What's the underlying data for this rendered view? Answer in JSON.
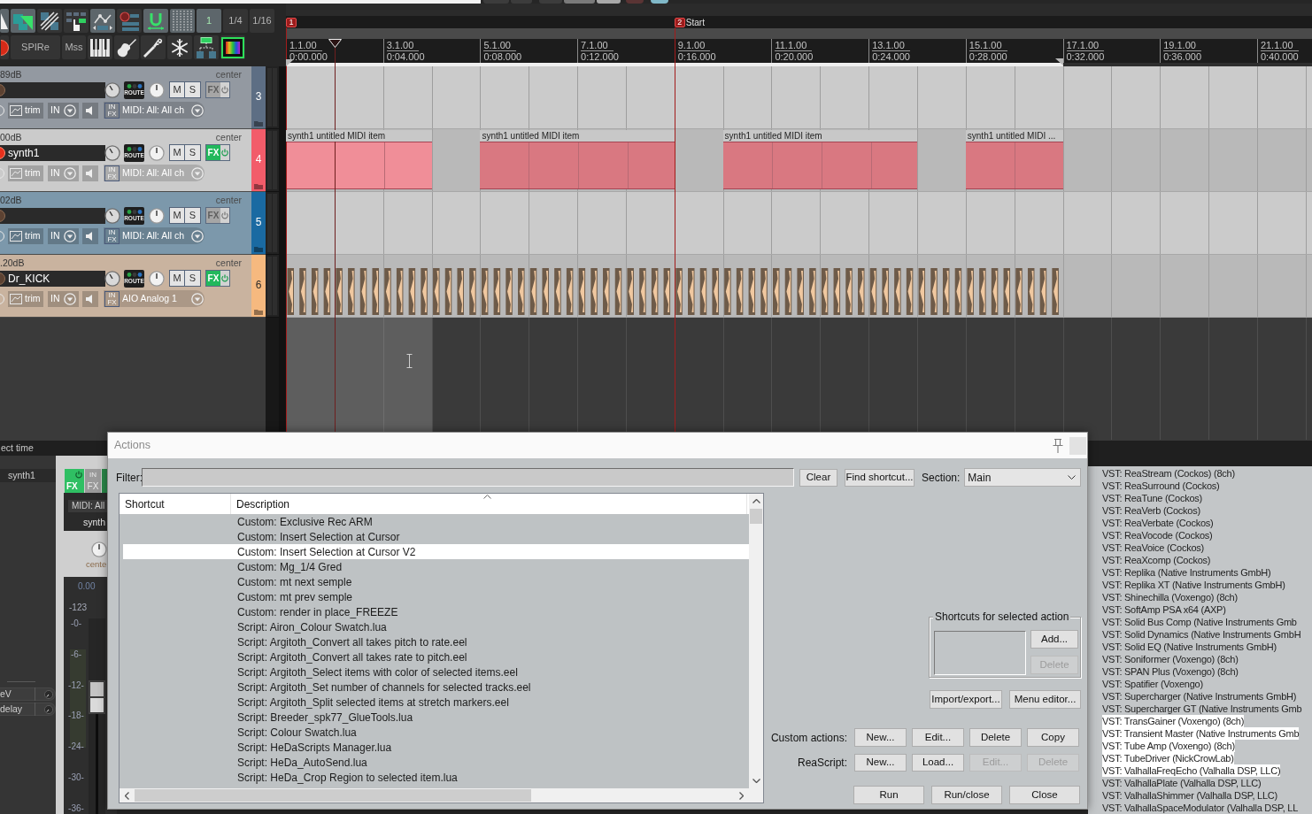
{
  "toolbar": {
    "rows": [
      [
        {
          "kind": "icon",
          "on": true
        },
        {
          "kind": "icon",
          "on": true
        },
        {
          "kind": "icon",
          "on": false
        },
        {
          "kind": "icon",
          "on": false
        },
        {
          "kind": "icon",
          "on": true
        },
        {
          "kind": "icon",
          "on": false
        },
        {
          "kind": "icon",
          "on": true
        },
        {
          "kind": "icon",
          "on": true
        },
        {
          "kind": "text",
          "label": "1",
          "on": true
        },
        {
          "kind": "text",
          "label": "1/4",
          "on": false
        },
        {
          "kind": "text",
          "label": "1/16",
          "on": false
        }
      ],
      [
        {
          "kind": "icon",
          "on": false
        },
        {
          "kind": "text",
          "label": "SPIRe",
          "on": false
        },
        {
          "kind": "text",
          "label": "Mss",
          "on": false
        },
        {
          "kind": "icon",
          "on": false
        },
        {
          "kind": "icon",
          "on": false
        },
        {
          "kind": "icon",
          "on": false
        },
        {
          "kind": "icon",
          "on": false
        },
        {
          "kind": "icon",
          "on": false
        },
        {
          "kind": "icon",
          "on": false
        }
      ]
    ]
  },
  "tracks": [
    {
      "number": "3",
      "volume": "89dB",
      "pan": "center",
      "armed": false,
      "fx_on": false,
      "selected": false,
      "color": "#5d6e84",
      "route_label": "ROUTE",
      "mute_label": "M",
      "solo_label": "S",
      "fx_label": "FX",
      "trim_label": "trim",
      "in_label": "IN",
      "input_fx": [
        "IN",
        "FX"
      ],
      "input": "MIDI: All: All ch",
      "kind": "empty"
    },
    {
      "number": "4",
      "volume": "00dB",
      "pan": "center",
      "name": "synth1",
      "armed": true,
      "fx_on": true,
      "selected": true,
      "color": "#f25c6a",
      "route_label": "ROUTE",
      "mute_label": "M",
      "solo_label": "S",
      "fx_label": "FX",
      "trim_label": "trim",
      "in_label": "IN",
      "input_fx": [
        "IN",
        "FX"
      ],
      "input": "MIDI: All: All ch",
      "kind": "midi",
      "items": [
        {
          "label": "synth1 untitled MIDI item",
          "selected": true
        },
        {
          "label": "synth1 untitled MIDI item",
          "selected": false
        },
        {
          "label": "synth1 untitled MIDI item",
          "selected": false
        },
        {
          "label": "synth1 untitled MIDI ...",
          "selected": false
        }
      ]
    },
    {
      "number": "5",
      "volume": "02dB",
      "pan": "center",
      "armed": false,
      "fx_on": false,
      "selected": false,
      "color": "#1a6aa2",
      "route_label": "ROUTE",
      "mute_label": "M",
      "solo_label": "S",
      "fx_label": "FX",
      "trim_label": "trim",
      "in_label": "IN",
      "input_fx": [
        "IN",
        "FX"
      ],
      "input": "MIDI: All: All ch",
      "kind": "empty"
    },
    {
      "number": "6",
      "volume": ".20dB",
      "pan": "center",
      "name": "Dr_KICK",
      "armed": false,
      "fx_on": true,
      "selected": false,
      "color": "#f6b97f",
      "route_label": "ROUTE",
      "mute_label": "M",
      "solo_label": "S",
      "fx_label": "FX",
      "trim_label": "trim",
      "in_label": "IN",
      "input_fx": [
        "IN",
        "FX"
      ],
      "input": "AIO Analog 1",
      "kind": "audio"
    }
  ],
  "markers": [
    {
      "number": "1"
    },
    {
      "number": "2",
      "name": "Start"
    }
  ],
  "ruler": [
    {
      "bar": "1.1.00",
      "time": "0:00.000"
    },
    {
      "bar": "3.1.00",
      "time": "0:04.000"
    },
    {
      "bar": "5.1.00",
      "time": "0:08.000"
    },
    {
      "bar": "7.1.00",
      "time": "0:12.000"
    },
    {
      "bar": "9.1.00",
      "time": "0:16.000"
    },
    {
      "bar": "11.1.00",
      "time": "0:20.000"
    },
    {
      "bar": "13.1.00",
      "time": "0:24.000"
    },
    {
      "bar": "15.1.00",
      "time": "0:28.000"
    },
    {
      "bar": "17.1.00",
      "time": "0:32.000"
    },
    {
      "bar": "19.1.00",
      "time": "0:36.000"
    },
    {
      "bar": "21.1.00",
      "time": "0:40.000"
    }
  ],
  "status_strip": {
    "text": "ect time"
  },
  "fx_chain_panel": {
    "title": "synth1",
    "params": [
      "eV",
      "delay"
    ]
  },
  "mixer_strip": {
    "fx": {
      "label": "FX",
      "on": true
    },
    "input_fx": {
      "top": "IN",
      "label": "FX"
    },
    "input": "MIDI: All",
    "name": "synth",
    "pan": "cente",
    "volume": "0.00",
    "peak": "-123",
    "scale": [
      "-0-",
      "-6-",
      "-12-",
      "-18-",
      "-24-",
      "-30-",
      "-36-"
    ],
    "fader": {
      "level": 0.6
    }
  },
  "actions_dialog": {
    "title": "Actions",
    "filter_label": "Filter:",
    "clear_button": "Clear",
    "find_button": "Find shortcut...",
    "section_label": "Section:",
    "section_value": "Main",
    "columns": [
      "Shortcut",
      "Description"
    ],
    "rows": [
      {
        "description": "Custom: Exclusive Rec ARM",
        "selected": false
      },
      {
        "description": "Custom: Insert Selection at Cursor",
        "selected": false
      },
      {
        "description": "Custom: Insert Selection at Cursor V2",
        "selected": true
      },
      {
        "description": "Custom: Mg_1/4 Gred",
        "selected": false
      },
      {
        "description": "Custom: mt next semple",
        "selected": false
      },
      {
        "description": "Custom: mt prev semple",
        "selected": false
      },
      {
        "description": "Custom: render in place_FREEZE",
        "selected": false
      },
      {
        "description": "Script: Airon_Colour Swatch.lua",
        "selected": false
      },
      {
        "description": "Script: Argitoth_Convert all takes pitch to rate.eel",
        "selected": false
      },
      {
        "description": "Script: Argitoth_Convert all takes rate to pitch.eel",
        "selected": false
      },
      {
        "description": "Script: Argitoth_Select items with color of selected items.eel",
        "selected": false
      },
      {
        "description": "Script: Argitoth_Set number of channels for selected tracks.eel",
        "selected": false
      },
      {
        "description": "Script: Argitoth_Split selected items at stretch markers.eel",
        "selected": false
      },
      {
        "description": "Script: Breeder_spk77_GlueTools.lua",
        "selected": false
      },
      {
        "description": "Script: Colour Swatch.lua",
        "selected": false
      },
      {
        "description": "Script: HeDaScripts Manager.lua",
        "selected": false
      },
      {
        "description": "Script: HeDa_AutoSend.lua",
        "selected": false
      },
      {
        "description": "Script: HeDa_Crop Region to selected item.lua",
        "selected": false
      }
    ],
    "shortcuts_group": {
      "title": "Shortcuts for selected action",
      "buttons": [
        {
          "label": "Add...",
          "disabled": false
        },
        {
          "label": "Delete",
          "disabled": true
        }
      ]
    },
    "tool_buttons": [
      "Import/export...",
      "Menu editor..."
    ],
    "custom_actions": {
      "label": "Custom actions:",
      "buttons": [
        {
          "label": "New...",
          "disabled": false
        },
        {
          "label": "Edit...",
          "disabled": false
        },
        {
          "label": "Delete",
          "disabled": false
        },
        {
          "label": "Copy",
          "disabled": false
        }
      ]
    },
    "reascript": {
      "label": "ReaScript:",
      "buttons": [
        {
          "label": "New...",
          "disabled": false
        },
        {
          "label": "Load...",
          "disabled": false
        },
        {
          "label": "Edit...",
          "disabled": true
        },
        {
          "label": "Delete",
          "disabled": true
        }
      ]
    },
    "run_buttons": [
      "Run",
      "Run/close",
      "Close"
    ]
  },
  "fx_browser": {
    "items": [
      {
        "label": "VST: ReaStream (Cockos) (8ch)",
        "selected": false
      },
      {
        "label": "VST: ReaSurround (Cockos)",
        "selected": false
      },
      {
        "label": "VST: ReaTune (Cockos)",
        "selected": false
      },
      {
        "label": "VST: ReaVerb (Cockos)",
        "selected": false
      },
      {
        "label": "VST: ReaVerbate (Cockos)",
        "selected": false
      },
      {
        "label": "VST: ReaVocode (Cockos)",
        "selected": false
      },
      {
        "label": "VST: ReaVoice (Cockos)",
        "selected": false
      },
      {
        "label": "VST: ReaXcomp (Cockos)",
        "selected": false
      },
      {
        "label": "VST: Replika (Native Instruments GmbH)",
        "selected": false
      },
      {
        "label": "VST: Replika XT (Native Instruments GmbH)",
        "selected": false
      },
      {
        "label": "VST: Shinechilla (Voxengo) (8ch)",
        "selected": false
      },
      {
        "label": "VST: SoftAmp PSA x64 (AXP)",
        "selected": false
      },
      {
        "label": "VST: Solid Bus Comp (Native Instruments Gmb",
        "selected": false
      },
      {
        "label": "VST: Solid Dynamics (Native Instruments GmbH",
        "selected": false
      },
      {
        "label": "VST: Solid EQ (Native Instruments GmbH)",
        "selected": false
      },
      {
        "label": "VST: Soniformer (Voxengo) (8ch)",
        "selected": false
      },
      {
        "label": "VST: SPAN Plus (Voxengo) (8ch)",
        "selected": false
      },
      {
        "label": "VST: Spatifier (Voxengo)",
        "selected": false
      },
      {
        "label": "VST: Supercharger (Native Instruments GmbH)",
        "selected": false
      },
      {
        "label": "VST: Supercharger GT (Native Instruments Gmb",
        "selected": false
      },
      {
        "label": "VST: TransGainer (Voxengo) (8ch)",
        "selected": true
      },
      {
        "label": "VST: Transient Master (Native Instruments Gmb",
        "selected": true
      },
      {
        "label": "VST: Tube Amp (Voxengo) (8ch)",
        "selected": true
      },
      {
        "label": "VST: TubeDriver (NickCrowLab)",
        "selected": true
      },
      {
        "label": "VST: ValhallaFreqEcho (Valhalla DSP, LLC)",
        "selected": true
      },
      {
        "label": "VST: ValhallaPlate (Valhalla DSP, LLC)",
        "selected": false
      },
      {
        "label": "VST: ValhallaShimmer (Valhalla DSP, LLC)",
        "selected": false
      },
      {
        "label": "VST: ValhallaSpaceModulator (Valhalla DSP, LL",
        "selected": false
      }
    ]
  }
}
